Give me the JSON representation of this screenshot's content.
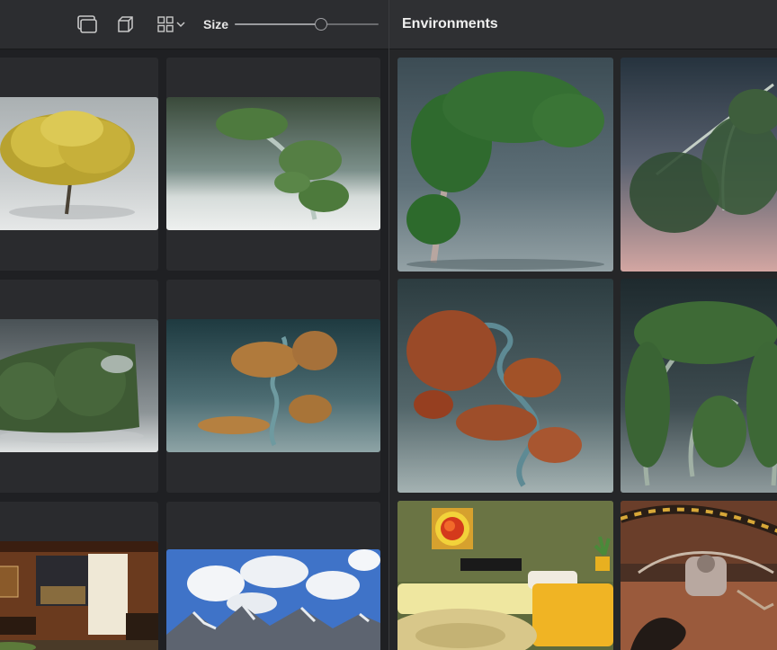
{
  "toolbar": {
    "window_icon": "window-stack-icon",
    "cube_icon": "3d-cube-icon",
    "grid_icon": "grid-view-icon",
    "dropdown_icon": "chevron-down-icon",
    "size_label": "Size",
    "size_value": 0.6
  },
  "library": {
    "items": [
      {
        "name": "yellow-tree"
      },
      {
        "name": "windswept-green-tree"
      },
      {
        "name": "green-hedge"
      },
      {
        "name": "autumn-twisted-tree"
      },
      {
        "name": "interior-room"
      },
      {
        "name": "clouds-mountains"
      }
    ]
  },
  "environments": {
    "title": "Environments",
    "items": [
      {
        "name": "green-leaning-tree"
      },
      {
        "name": "weeping-branches"
      },
      {
        "name": "orange-twisted-tree"
      },
      {
        "name": "arched-green-tree"
      },
      {
        "name": "retro-lounge"
      },
      {
        "name": "sci-fi-machine"
      }
    ]
  }
}
